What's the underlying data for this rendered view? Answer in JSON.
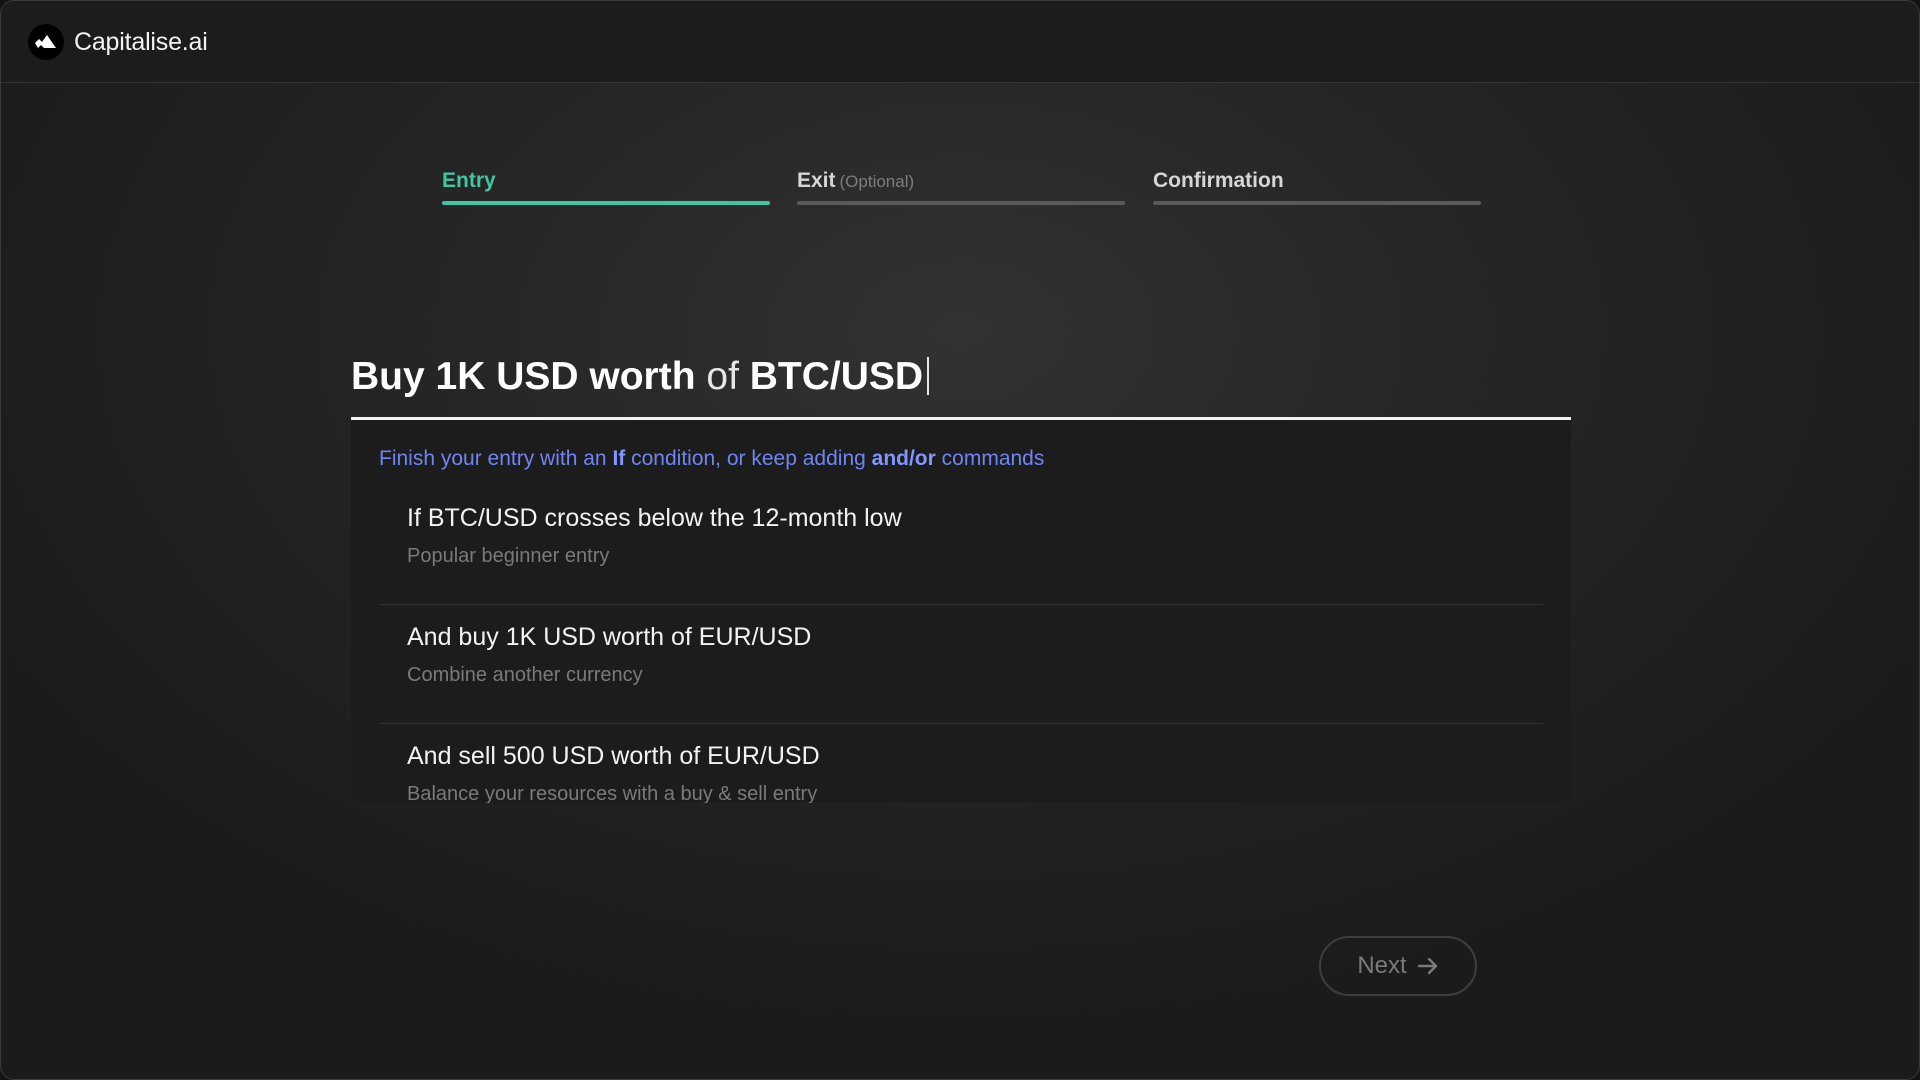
{
  "app": {
    "brand_name": "Capitalise.ai",
    "logo_icon": "mountain-logo-icon"
  },
  "steps": [
    {
      "label": "Entry",
      "optional_label": "",
      "active": true
    },
    {
      "label": "Exit",
      "optional_label": "(Optional)",
      "active": false
    },
    {
      "label": "Confirmation",
      "optional_label": "",
      "active": false
    }
  ],
  "command": {
    "part1": "Buy 1K USD worth",
    "part2": "of",
    "part3": "BTC/USD"
  },
  "hint": {
    "pre": "Finish your entry with an",
    "kw1": "If",
    "mid": "condition, or keep adding",
    "kw2": "and/or",
    "post": "commands"
  },
  "suggestions": [
    {
      "title": "If BTC/USD crosses below the 12-month low",
      "subtitle": "Popular beginner entry"
    },
    {
      "title": "And buy 1K USD worth of EUR/USD",
      "subtitle": "Combine another currency"
    },
    {
      "title": "And sell 500 USD worth of EUR/USD",
      "subtitle": "Balance your resources with a buy & sell entry"
    }
  ],
  "next_button": {
    "label": "Next",
    "icon": "arrow-right-icon"
  },
  "colors": {
    "accent": "#3ec7a1",
    "hint": "#6f86f2",
    "background": "#262626"
  }
}
